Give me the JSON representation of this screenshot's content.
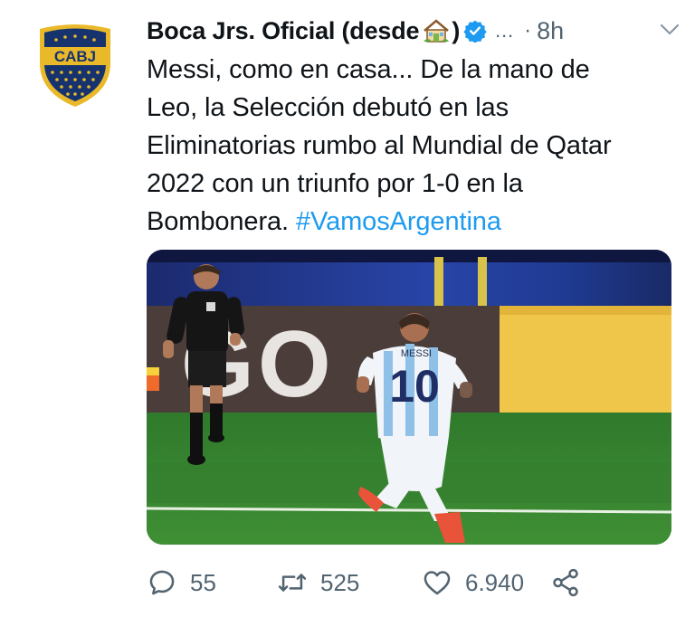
{
  "tweet": {
    "author_name": "Boca Jrs. Oficial (desde",
    "author_name_suffix": ")",
    "more_indicator": "…",
    "time_separator": "·",
    "time": "8h",
    "text_lines": [
      "Messi, como en casa... De la mano de",
      "Leo, la Selección debutó en las",
      "Eliminatorias rumbo al Mundial de Qatar",
      "2022 con un triunfo por 1-0 en la",
      "Bombonera."
    ],
    "hashtag": "#VamosArgentina",
    "avatar_text": "CABJ",
    "media": {
      "jersey_name": "MESSI",
      "jersey_number": "10",
      "board_text": "GO"
    },
    "replies": "55",
    "retweets": "525",
    "likes": "6.940"
  },
  "colors": {
    "link": "#1d9bf0",
    "verified": "#1d9bf0",
    "muted": "#536471",
    "avatar_blue": "#16336e",
    "avatar_gold": "#e9b92a"
  },
  "icons": [
    "boca-crest-icon",
    "house-emoji-icon",
    "verified-badge-icon",
    "chevron-down-icon",
    "reply-icon",
    "retweet-icon",
    "like-icon",
    "share-icon"
  ]
}
